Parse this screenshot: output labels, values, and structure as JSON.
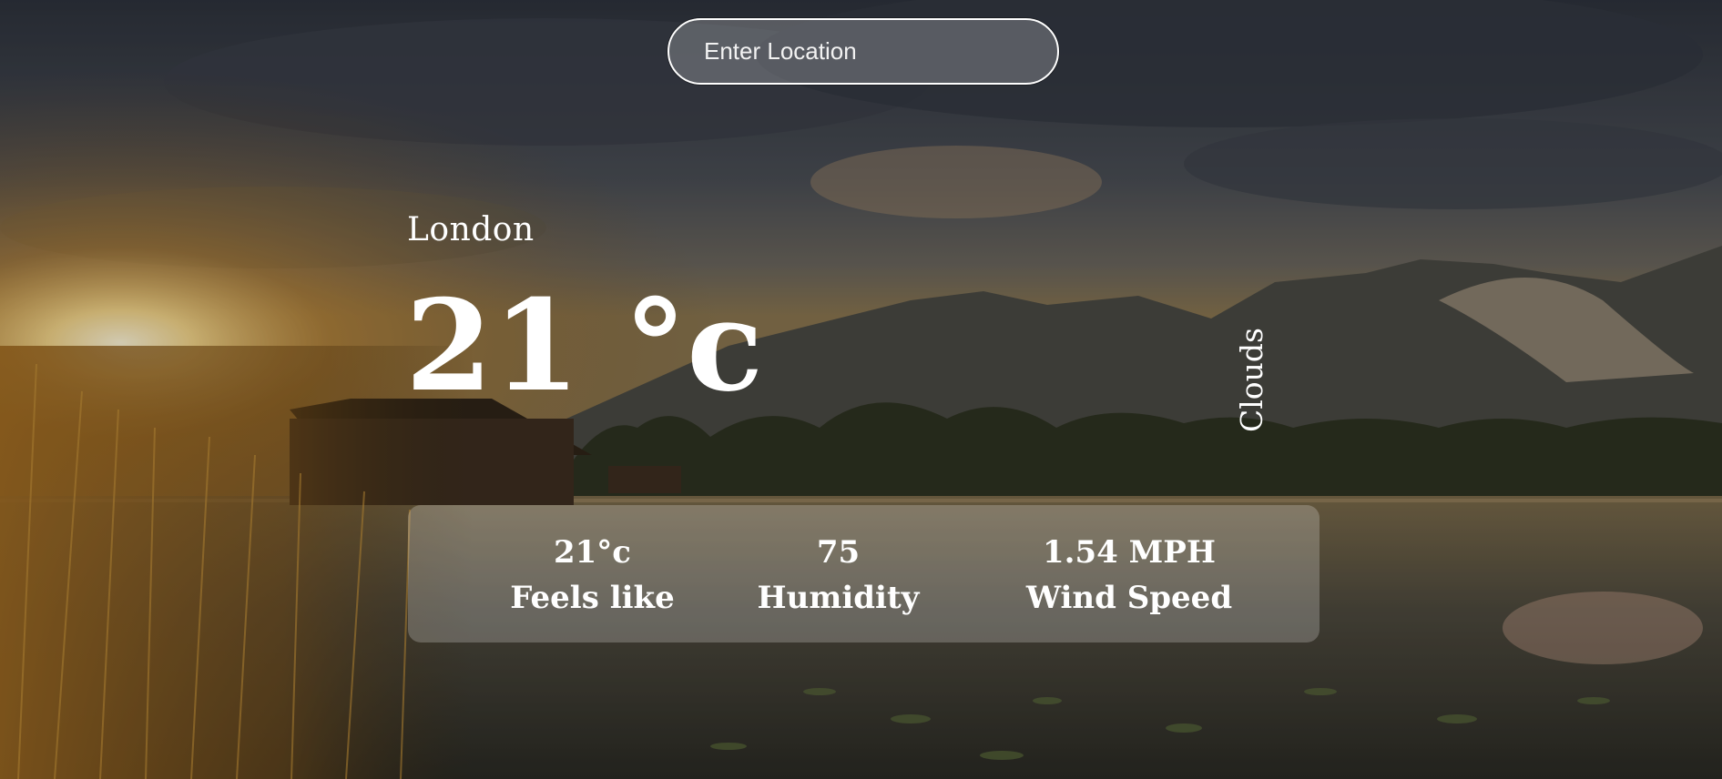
{
  "search": {
    "placeholder": "Enter Location",
    "icon": "none"
  },
  "weather": {
    "city": "London",
    "temperature": "21 °c",
    "description": "Clouds"
  },
  "stats": {
    "feels_like_value": "21°c",
    "feels_like_label": "Feels like",
    "humidity_value": "75",
    "humidity_label": "Humidity",
    "wind_value": "1.54 MPH",
    "wind_label": "Wind Speed"
  },
  "colors": {
    "text": "#ffffff",
    "card_bg": "rgba(255,255,255,0.22)"
  }
}
